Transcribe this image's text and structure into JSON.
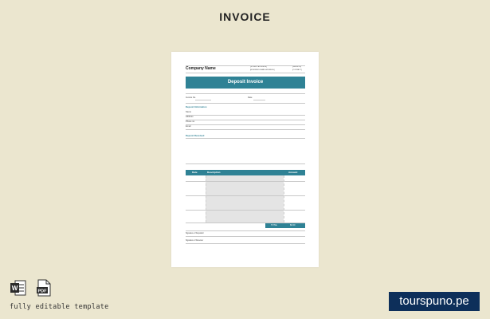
{
  "page": {
    "title": "INVOICE"
  },
  "invoice": {
    "company_name": "Company Name",
    "header_right": [
      "[STREET ADDRESS]",
      "[BUSINESS EMAIL ADDRESS]",
      "[WEBSITE]",
      "[CONTACT]"
    ],
    "banner": "Deposit Invoice",
    "invoice_no_label": "Invoice No.",
    "date_label": "Date",
    "deposit_info_label": "Deposit Information",
    "fields": [
      "Name",
      "Address",
      "Phone no.",
      "Email"
    ],
    "deposit_received_label": "Deposit Received",
    "table_headers": {
      "date": "Date",
      "description": "Description",
      "amount": "Amount"
    },
    "total_label": "TOTAL",
    "total_value": "$0.00",
    "signature_depositor": "Signature of Depositor",
    "signature_receiver": "Signature of Receiver"
  },
  "footer": {
    "formats": [
      "W",
      "PDF"
    ],
    "caption": "fully editable template",
    "brand": "tourspuno.pe"
  },
  "colors": {
    "background": "#ebe6cf",
    "accent": "#2f8295",
    "brand": "#0d2f5a"
  }
}
